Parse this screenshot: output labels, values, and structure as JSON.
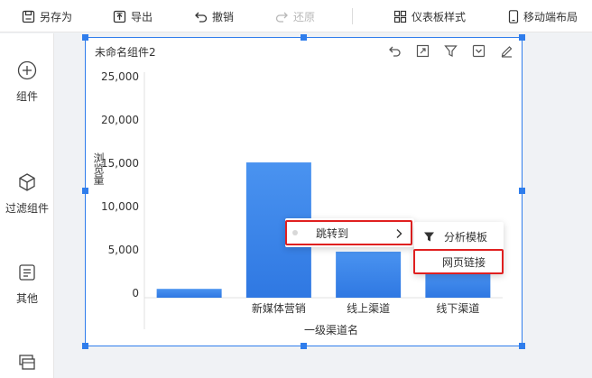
{
  "toolbar": {
    "save_as": "另存为",
    "export": "导出",
    "undo": "撤销",
    "redo": "还原",
    "dashboard_style": "仪表板样式",
    "mobile_layout": "移动端布局"
  },
  "sidebar": {
    "items": [
      {
        "label": "组件",
        "icon": "plus-circle-icon"
      },
      {
        "label": "过滤组件",
        "icon": "cube-icon"
      },
      {
        "label": "其他",
        "icon": "document-icon"
      },
      {
        "label": "",
        "icon": "layers-icon"
      }
    ]
  },
  "widget": {
    "title": "未命名组件2",
    "tools": [
      "undo-icon",
      "expand-icon",
      "filter-icon",
      "dropdown-box-icon",
      "edit-icon"
    ]
  },
  "colors": {
    "accent": "#2f7dec",
    "bar": "#3b86ea",
    "highlight": "#e02020"
  },
  "chart_data": {
    "type": "bar",
    "categories": [
      "",
      "新媒体营销",
      "线上渠道",
      "线下渠道"
    ],
    "values": [
      500,
      15100,
      4800,
      2600
    ],
    "xlabel": "一级渠道名",
    "ylabel": "浏览量",
    "ylim": [
      0,
      25000
    ],
    "yticks": [
      "25,000",
      "20,000",
      "15,000",
      "10,000",
      "5,000",
      "0"
    ]
  },
  "context_menu": {
    "item": "跳转到"
  },
  "submenu": {
    "items": [
      "分析模板",
      "网页链接"
    ]
  }
}
